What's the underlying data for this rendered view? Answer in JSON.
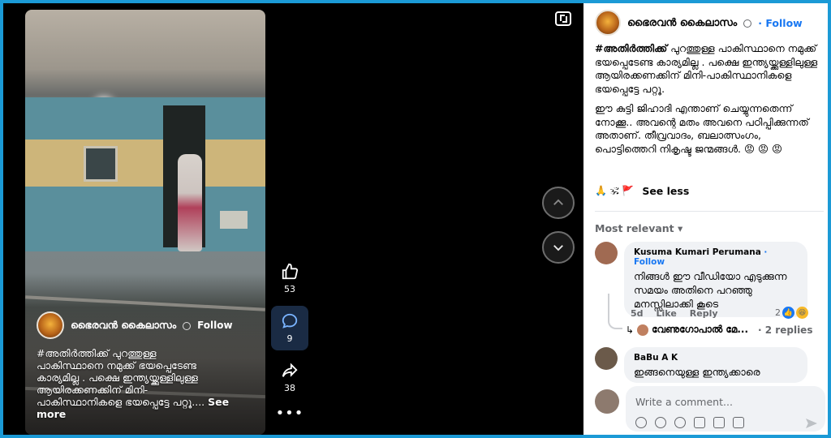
{
  "video": {
    "author_name": "ഭൈരവൻ കൈലാസം",
    "follow_label": "Follow",
    "caption_lines": [
      "#അതിർത്തിക്ക് പുറത്തുള്ള",
      "പാകിസ്ഥാനെ നമുക്ക് ഭയപ്പെടേണ്ട",
      "കാര്യമില്ല . പക്ഷെ ഇന്ത്യയ്ക്കുള്ളിലുള്ള",
      "ആയിരക്കണക്കിന് മിനി-",
      "പാകിസ്ഥാനികളെ  ഭയപ്പെട്ടേ പറ്റൂ...."
    ],
    "see_more": "See more"
  },
  "actions": {
    "like_count": "53",
    "comment_count": "9",
    "share_count": "38",
    "more_label": "•••"
  },
  "post": {
    "author_name": "ഭൈരവൻ കൈലാസം",
    "follow_label": "Follow",
    "hashtag": "#അതിർത്തിക്ക്",
    "para1_rest": " പുറത്തുള്ള പാകിസ്ഥാനെ നമുക്ക് ഭയപ്പെടേണ്ട കാര്യമില്ല . പക്ഷെ ഇന്ത്യയ്ക്കുള്ളിലുള്ള ആയിരക്കണക്കിന് മിനി-പാകിസ്ഥാനികളെ  ഭയപ്പെട്ടേ പറ്റൂ.",
    "para2": "ഈ കുട്ടി ജിഹാദി എന്താണ് ചെയ്യുന്നതെന്ന് നോക്കൂ.. അവന്റെ മതം അവനെ പഠിപ്പിക്കുന്നത് അതാണ്. തീവ്രവാദം, ബലാത്സംഗം, പൊട്ടിത്തെറി നികൃഷ്ട ജന്മങ്ങൾ. 😡 😡 😡",
    "emoji_row": "🙏 🕉 🚩",
    "see_less": "See less"
  },
  "comments": {
    "sort_label": "Most relevant ▾",
    "first": {
      "name": "Kusuma Kumari Perumana",
      "follow": " · Follow",
      "text": "നിങ്ങൾ ഈ വീഡിയോ എടുക്കുന്ന സമയം അതിനെ പറഞ്ഞു മനസ്സിലാക്കി കൂടെ",
      "time": "5d",
      "like": "Like",
      "reply": "Reply",
      "reaction_count": "2"
    },
    "reply_preview": {
      "name": "വേണുഗോപാൽ മേ...",
      "count": "· 2 replies"
    },
    "second": {
      "name": "BaBu A K",
      "text": "ഇങ്ങനെയുള്ള ഇന്ത്യക്കാരെ"
    },
    "composer_placeholder": "Write a comment..."
  }
}
